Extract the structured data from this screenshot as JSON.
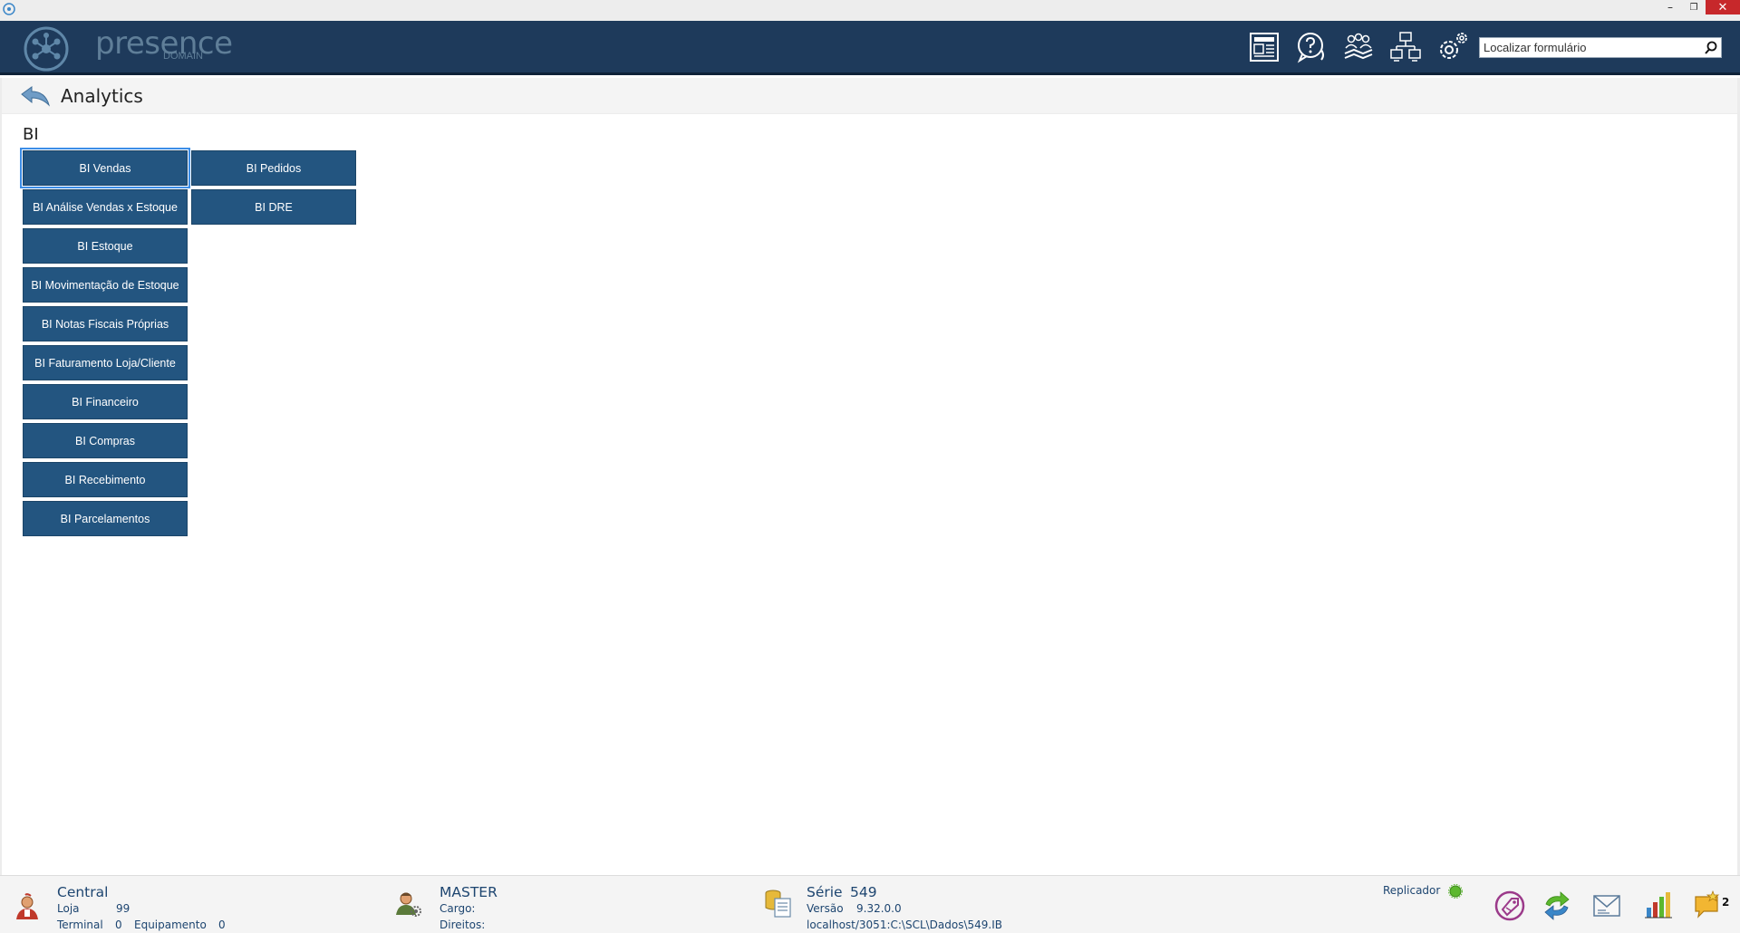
{
  "window": {
    "minimize": "–",
    "restore": "❐",
    "close": "✕"
  },
  "header": {
    "logo_text": "presence",
    "logo_sub": "DOMAIN",
    "icons": [
      "news-icon",
      "help-icon",
      "users-icon",
      "network-icon",
      "settings-icon"
    ],
    "search_placeholder": "Localizar formulário"
  },
  "page": {
    "title": "Analytics",
    "section": "BI"
  },
  "buttons": {
    "col1": [
      "BI Vendas",
      "BI Análise Vendas x Estoque",
      "BI Estoque",
      "BI Movimentação de Estoque",
      "BI Notas Fiscais Próprias",
      "BI Faturamento Loja/Cliente",
      "BI Financeiro",
      "BI Compras",
      "BI Recebimento",
      "BI Parcelamentos"
    ],
    "col2": [
      "BI Pedidos",
      "BI DRE"
    ]
  },
  "status": {
    "store_name": "Central",
    "loja_label": "Loja",
    "loja_value": "99",
    "terminal_label": "Terminal",
    "terminal_value": "0",
    "equip_label": "Equipamento",
    "equip_value": "0",
    "user_name": "MASTER",
    "cargo_label": "Cargo:",
    "direitos_label": "Direitos:",
    "serie_label": "Série",
    "serie_value": "549",
    "versao_label": "Versão",
    "versao_value": "9.32.0.0",
    "db_path": "localhost/3051:C:\\SCL\\Dados\\549.IB",
    "replicador_label": "Replicador",
    "messages_count": "2"
  },
  "colors": {
    "header_bg": "#1e3a5b",
    "button_bg": "#235580",
    "status_text": "#1d4570",
    "replicador_ok": "#5cb82e"
  }
}
